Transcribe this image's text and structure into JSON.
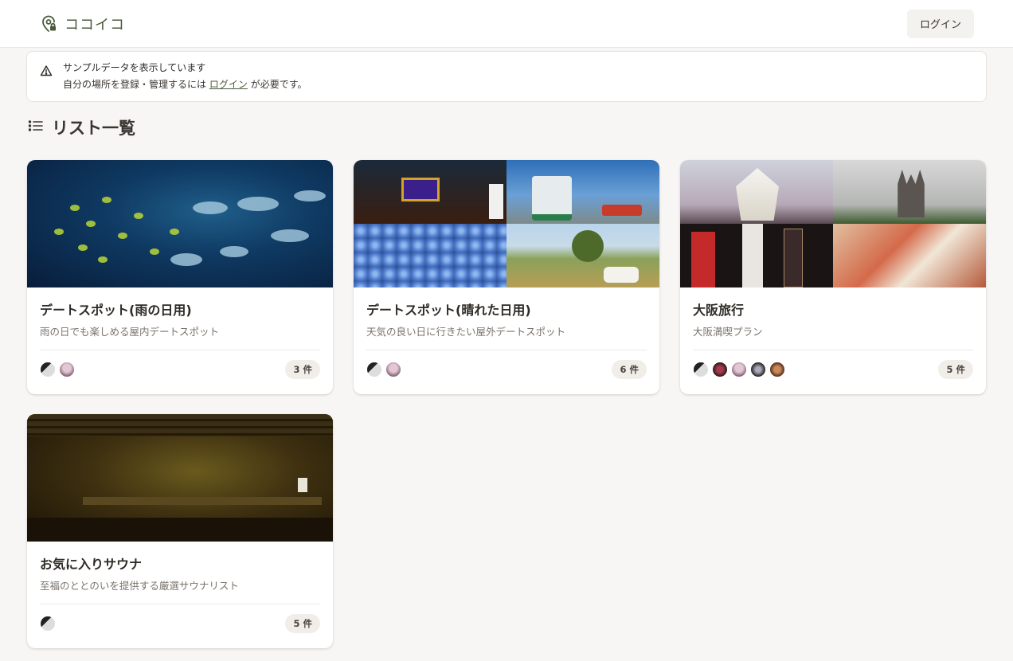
{
  "header": {
    "brand": "ココイコ",
    "login_label": "ログイン"
  },
  "notice": {
    "title": "サンプルデータを表示しています",
    "body_prefix": "自分の場所を登録・管理するには",
    "link": "ログイン",
    "body_suffix": "が必要です。"
  },
  "section": {
    "title": "リスト一覧"
  },
  "cards": [
    {
      "title": "デートスポット(雨の日用)",
      "description": "雨の日でも楽しめる屋内デートスポット",
      "count": "3 件",
      "avatars": 2
    },
    {
      "title": "デートスポット(晴れた日用)",
      "description": "天気の良い日に行きたい屋外デートスポット",
      "count": "6 件",
      "avatars": 2
    },
    {
      "title": "大阪旅行",
      "description": "大阪満喫プラン",
      "count": "5 件",
      "avatars": 5
    },
    {
      "title": "お気に入りサウナ",
      "description": "至福のととのいを提供する厳選サウナリスト",
      "count": "5 件",
      "avatars": 1
    }
  ],
  "colors": {
    "brand": "#4a5a3c",
    "background": "#f7f6f4"
  },
  "icons": {
    "brand": "location-pin-lock-icon",
    "notice": "warning-icon",
    "section": "list-icon"
  }
}
